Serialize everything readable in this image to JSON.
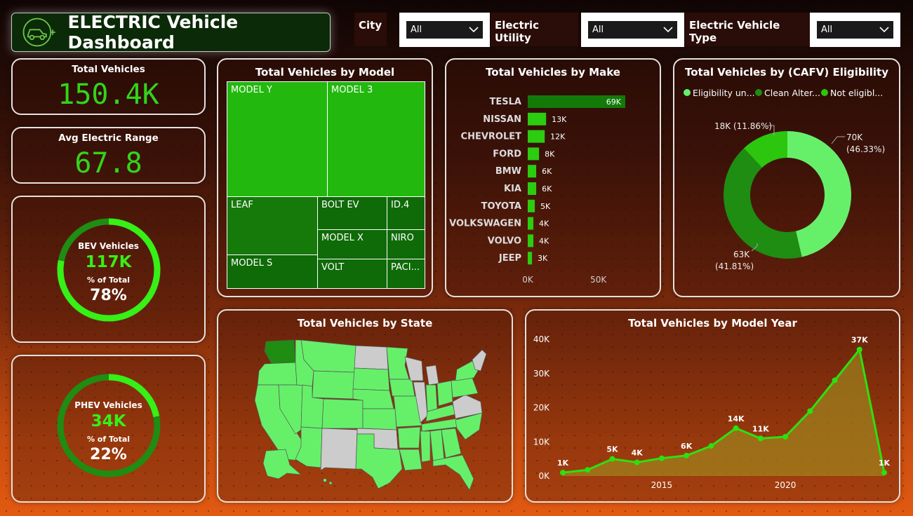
{
  "header": {
    "title": "ELECTRIC Vehicle Dashboard",
    "icon": "ev-car-plug-icon"
  },
  "slicers": [
    {
      "label": "City",
      "value": "All"
    },
    {
      "label": "Electric Utility",
      "value": "All"
    },
    {
      "label": "Electric Vehicle Type",
      "value": "All"
    }
  ],
  "kpis": {
    "total_vehicles": {
      "label": "Total Vehicles",
      "value": "150.4K"
    },
    "avg_range": {
      "label": "Avg Electric Range",
      "value": "67.8"
    }
  },
  "rings": {
    "bev": {
      "label": "BEV Vehicles",
      "value": "117K",
      "pct_label": "% of Total",
      "pct": "78%",
      "fraction": 0.78
    },
    "phev": {
      "label": "PHEV Vehicles",
      "value": "34K",
      "pct_label": "% of Total",
      "pct": "22%",
      "fraction": 0.22
    }
  },
  "colors": {
    "accent_green": "#33d41a",
    "light_green": "#66f06a",
    "dark_green": "#1f8c12",
    "mid_green": "#2cc60e"
  },
  "chart_data": [
    {
      "type": "treemap",
      "title": "Total Vehicles by Model",
      "items": [
        "MODEL Y",
        "MODEL 3",
        "LEAF",
        "BOLT EV",
        "ID.4",
        "MODEL X",
        "NIRO",
        "MODEL S",
        "VOLT",
        "PACI..."
      ]
    },
    {
      "type": "bar",
      "title": "Total Vehicles by Make",
      "categories": [
        "TESLA",
        "NISSAN",
        "CHEVROLET",
        "FORD",
        "BMW",
        "KIA",
        "TOYOTA",
        "VOLKSWAGEN",
        "VOLVO",
        "JEEP"
      ],
      "values": [
        69000,
        13000,
        12000,
        8000,
        6000,
        6000,
        5000,
        4000,
        4000,
        3000
      ],
      "data_labels": [
        "69K",
        "13K",
        "12K",
        "8K",
        "6K",
        "6K",
        "5K",
        "4K",
        "4K",
        "3K"
      ],
      "xticks": [
        "0K",
        "50K"
      ],
      "xlim": [
        0,
        70000
      ]
    },
    {
      "type": "pie",
      "title": "Total Vehicles by (CAFV) Eligibility",
      "legend": [
        "Eligibility un...",
        "Clean Alter...",
        "Not eligibl..."
      ],
      "values": [
        70000,
        63000,
        18000
      ],
      "labels": [
        "70K",
        "63K",
        "18K (11.86%)"
      ],
      "percent_labels": [
        "(46.33%)",
        "(41.81%)",
        ""
      ],
      "legend_position": "top"
    },
    {
      "type": "map",
      "title": "Total Vehicles by State"
    },
    {
      "type": "area",
      "title": "Total Vehicles by Model Year",
      "x": [
        2011,
        2012,
        2013,
        2014,
        2015,
        2016,
        2017,
        2018,
        2019,
        2020,
        2021,
        2022,
        2023,
        2024
      ],
      "values": [
        1000,
        1800,
        5000,
        4000,
        5200,
        6000,
        8800,
        14000,
        11000,
        11500,
        19000,
        28000,
        37000,
        1000
      ],
      "data_labels": [
        "1K",
        "",
        "5K",
        "4K",
        "",
        "6K",
        "",
        "14K",
        "11K",
        "",
        "",
        "",
        "37K",
        "1K"
      ],
      "yticks": [
        "0K",
        "10K",
        "20K",
        "30K",
        "40K"
      ],
      "xticks": [
        "2015",
        "2020"
      ],
      "ylim": [
        0,
        40000
      ]
    }
  ]
}
